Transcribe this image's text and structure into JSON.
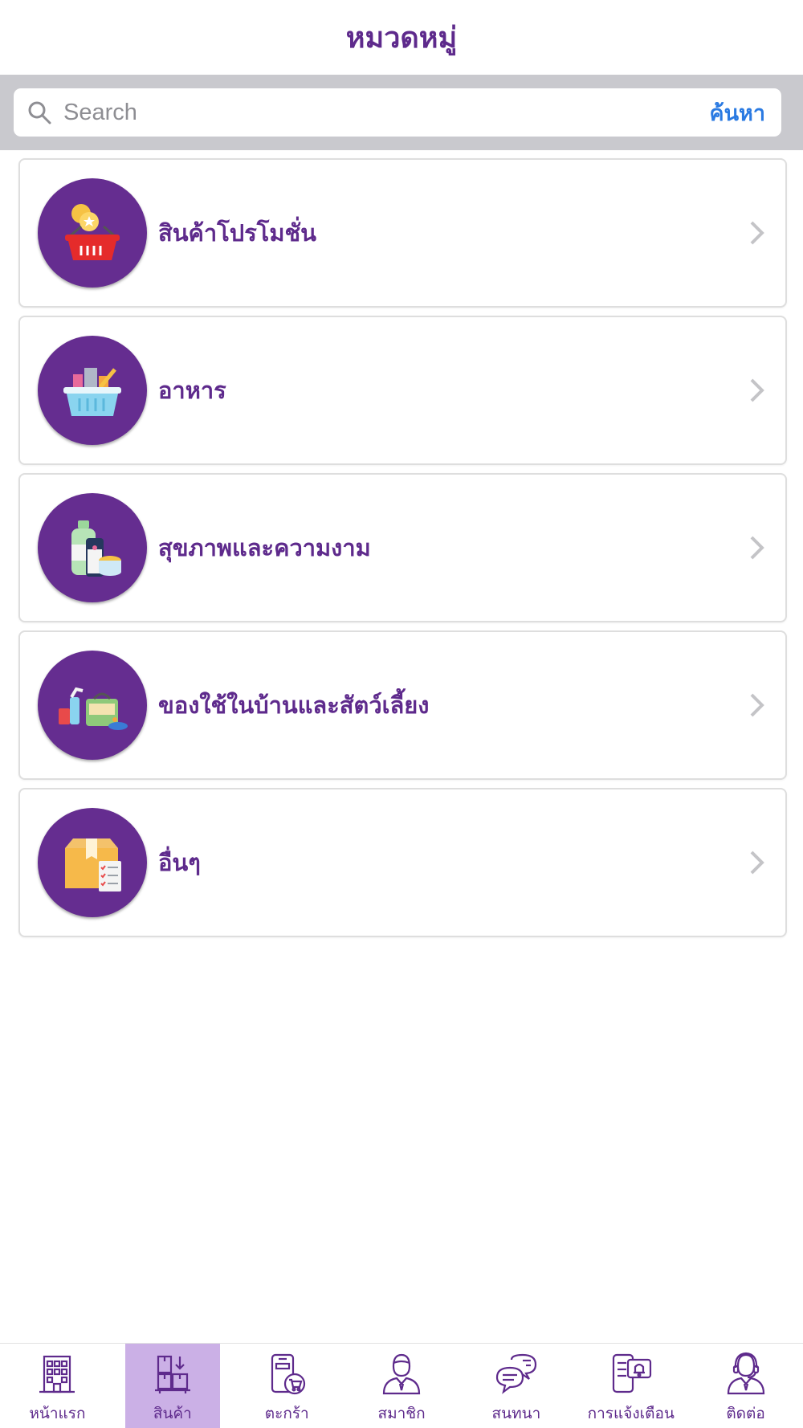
{
  "header": {
    "title": "หมวดหมู่"
  },
  "search": {
    "placeholder": "Search",
    "button_label": "ค้นหา"
  },
  "categories": [
    {
      "label": "สินค้าโปรโมชั่น",
      "icon": "promotion-basket-icon"
    },
    {
      "label": "อาหาร",
      "icon": "food-basket-icon"
    },
    {
      "label": "สุขภาพและความงาม",
      "icon": "health-beauty-icon"
    },
    {
      "label": "ของใช้ในบ้านและสัตว์เลี้ยง",
      "icon": "household-pets-icon"
    },
    {
      "label": "อื่นๆ",
      "icon": "other-box-icon"
    }
  ],
  "tabbar": {
    "items": [
      {
        "label": "หน้าแรก",
        "icon": "building-icon",
        "active": false
      },
      {
        "label": "สินค้า",
        "icon": "boxes-icon",
        "active": true
      },
      {
        "label": "ตะกร้า",
        "icon": "phone-cart-icon",
        "active": false
      },
      {
        "label": "สมาชิก",
        "icon": "member-icon",
        "active": false
      },
      {
        "label": "สนทนา",
        "icon": "chat-icon",
        "active": false
      },
      {
        "label": "การแจ้งเตือน",
        "icon": "notification-icon",
        "active": false
      },
      {
        "label": "ติดต่อ",
        "icon": "support-agent-icon",
        "active": false
      }
    ]
  },
  "colors": {
    "brand": "#5e2a8c",
    "icon_bg": "#652d90",
    "active_tab": "#cbb0e6",
    "link": "#2a7ae2"
  }
}
